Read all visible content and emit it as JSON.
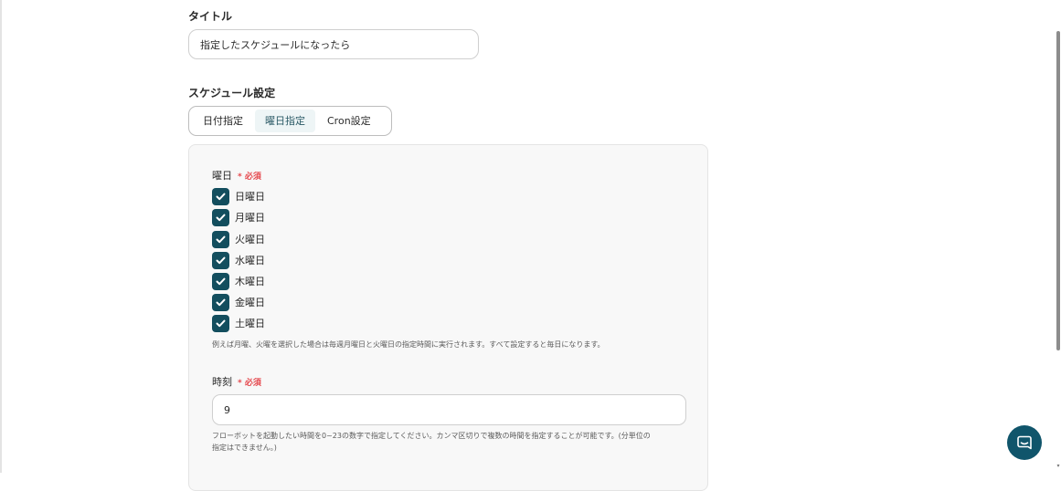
{
  "title_field": {
    "label": "タイトル",
    "value": "指定したスケジュールになったら"
  },
  "schedule": {
    "label": "スケジュール設定",
    "tabs": [
      {
        "label": "日付指定",
        "active": false
      },
      {
        "label": "曜日指定",
        "active": true
      },
      {
        "label": "Cron設定",
        "active": false
      }
    ]
  },
  "weekday_field": {
    "label": "曜日",
    "required_mark": "*",
    "required_text": "必須",
    "days": [
      {
        "label": "日曜日",
        "checked": true
      },
      {
        "label": "月曜日",
        "checked": true
      },
      {
        "label": "火曜日",
        "checked": true
      },
      {
        "label": "水曜日",
        "checked": true
      },
      {
        "label": "木曜日",
        "checked": true
      },
      {
        "label": "金曜日",
        "checked": true
      },
      {
        "label": "土曜日",
        "checked": true
      }
    ],
    "hint": "例えば月曜、火曜を選択した場合は毎週月曜日と火曜日の指定時間に実行されます。すべて設定すると毎日になります。"
  },
  "time_field": {
    "label": "時刻",
    "required_mark": "*",
    "required_text": "必須",
    "value": "9",
    "hint_line1": "フローボットを起動したい時間を0~23の数字で指定してください。カンマ区切りで複数の時間を指定することが可能です。(分単位の",
    "hint_line2": "指定はできません。)"
  },
  "colors": {
    "accent": "#134e5e",
    "required": "#e5484d",
    "chat_button": "#10556b"
  },
  "icons": {
    "checkbox": "check-icon",
    "chat": "chat-bubble-icon"
  }
}
